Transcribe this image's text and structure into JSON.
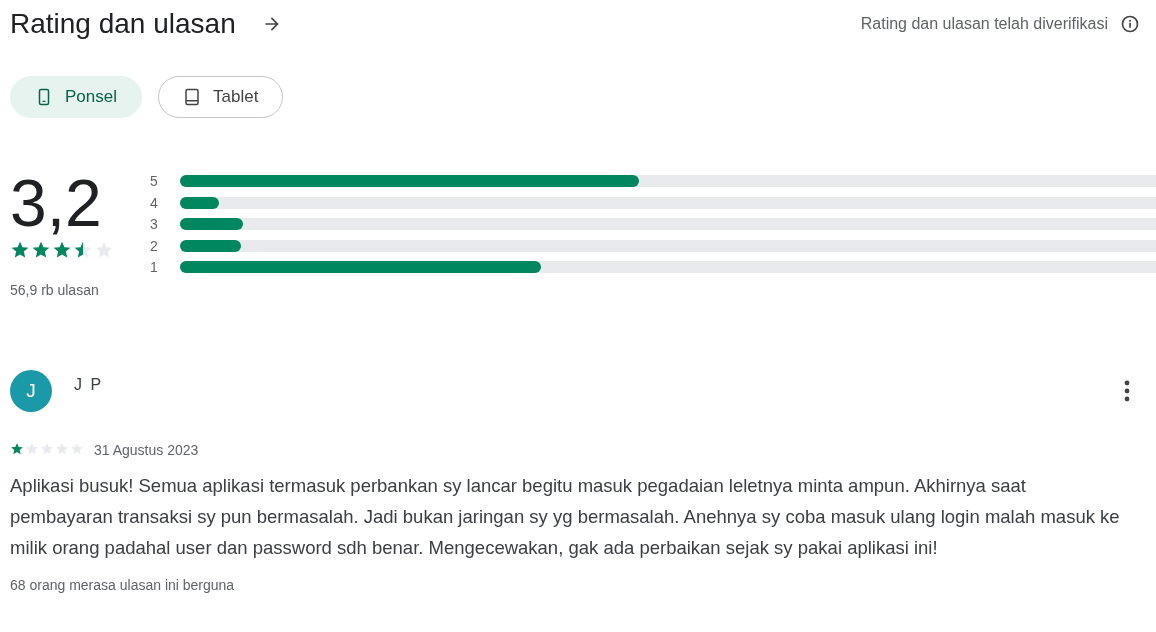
{
  "header": {
    "title": "Rating dan ulasan",
    "verified_note": "Rating dan ulasan telah diverifikasi"
  },
  "device_tabs": [
    {
      "label": "Ponsel",
      "kind": "phone",
      "selected": true
    },
    {
      "label": "Tablet",
      "kind": "tablet",
      "selected": false
    }
  ],
  "summary": {
    "score": "3,2",
    "stars": 3.5,
    "review_count": "56,9 rb ulasan",
    "bars": [
      {
        "label": "5",
        "level": 0.47
      },
      {
        "label": "4",
        "level": 0.04
      },
      {
        "label": "3",
        "level": 0.065
      },
      {
        "label": "2",
        "level": 0.063
      },
      {
        "label": "1",
        "level": 0.37
      }
    ]
  },
  "reviews": [
    {
      "avatar_letter": "J",
      "author": "J P",
      "stars": 1,
      "date": "31 Agustus 2023",
      "text_lines": [
        "Aplikasi busuk! Semua aplikasi termasuk perbankan sy lancar begitu masuk pegadaian leletnya minta ampun. Akhirnya saat",
        "pembayaran transaksi sy pun bermasalah. Jadi bukan jaringan sy yg bermasalah. Anehnya sy coba masuk ulang login malah masuk ke",
        "milik orang padahal user dan password sdh benar. Mengecewakan, gak ada perbaikan sejak sy pakai aplikasi ini!"
      ],
      "helpful": "68 orang merasa ulasan ini berguna"
    }
  ]
}
